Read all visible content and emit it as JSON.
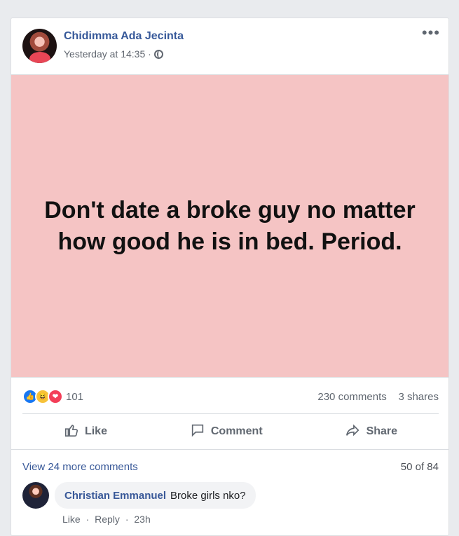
{
  "post": {
    "author": "Chidimma Ada Jecinta",
    "time": "Yesterday at 14:35 ·",
    "text": "Don't date a broke guy no matter how good he is in bed. Period.",
    "reaction_count": "101",
    "comments_count": "230 comments",
    "shares_count": "3 shares",
    "actions": {
      "like": "Like",
      "comment": "Comment",
      "share": "Share"
    },
    "view_more_comments": "View 24 more comments",
    "comments_position": "50 of 84"
  },
  "comment": {
    "author": "Christian Emmanuel",
    "text": "Broke girls nko?",
    "like": "Like",
    "reply": "Reply",
    "time": "23h"
  },
  "icons": {
    "globe": "globe-icon",
    "more": "more-options-icon",
    "like": "thumbs-up-icon",
    "comment": "comment-icon",
    "share": "share-icon"
  },
  "colors": {
    "post_background": "#f5c4c4",
    "link": "#385898",
    "page_bg": "#e9ebee"
  }
}
